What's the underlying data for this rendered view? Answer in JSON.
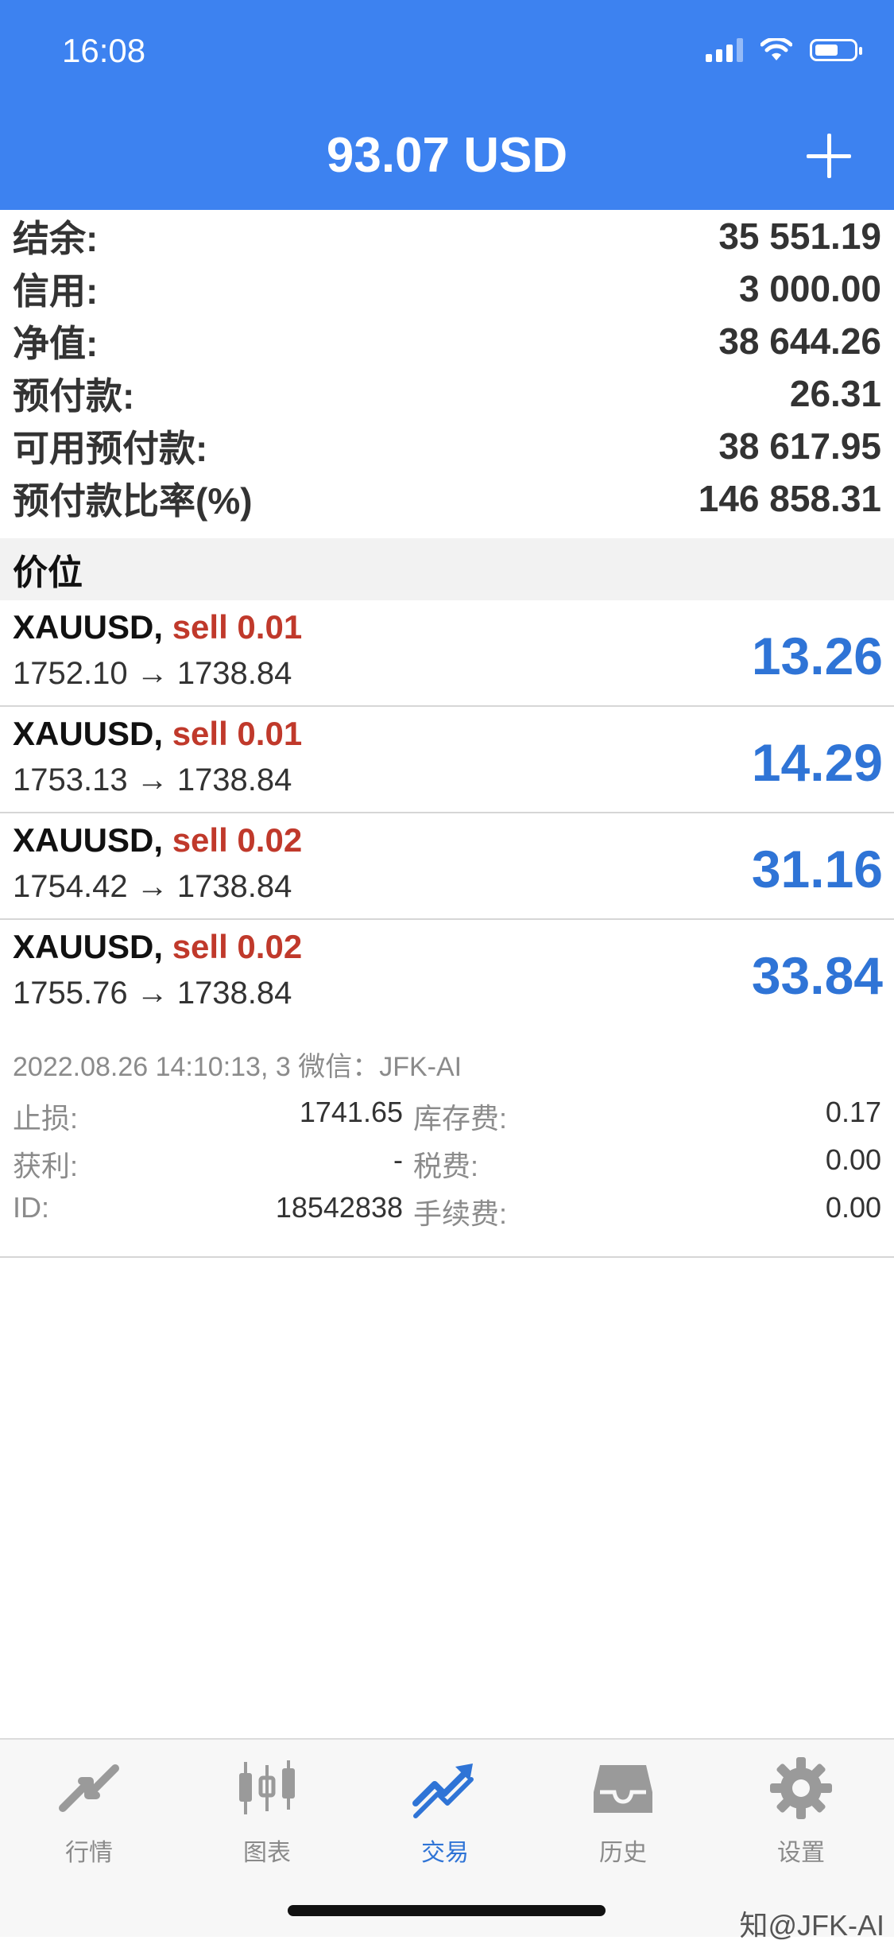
{
  "status": {
    "time": "16:08"
  },
  "header": {
    "balance": "93.07 USD"
  },
  "summary": [
    {
      "label": "结余:",
      "value": "35 551.19"
    },
    {
      "label": "信用:",
      "value": "3 000.00"
    },
    {
      "label": "净值:",
      "value": "38 644.26"
    },
    {
      "label": "预付款:",
      "value": "26.31"
    },
    {
      "label": "可用预付款:",
      "value": "38 617.95"
    },
    {
      "label": "预付款比率(%)",
      "value": "146 858.31"
    }
  ],
  "section": {
    "title": "价位"
  },
  "positions": [
    {
      "symbol": "XAUUSD,",
      "side": "sell 0.01",
      "prices": "1752.10 → 1738.84",
      "profit": "13.26"
    },
    {
      "symbol": "XAUUSD,",
      "side": "sell 0.01",
      "prices": "1753.13 → 1738.84",
      "profit": "14.29"
    },
    {
      "symbol": "XAUUSD,",
      "side": "sell 0.02",
      "prices": "1754.42 → 1738.84",
      "profit": "31.16"
    },
    {
      "symbol": "XAUUSD,",
      "side": "sell 0.02",
      "prices": "1755.76 → 1738.84",
      "profit": "33.84"
    }
  ],
  "details": {
    "meta": "2022.08.26 14:10:13, 3 微信：JFK-AI",
    "rows": [
      {
        "l1": "止损:",
        "v1": "1741.65",
        "l2": "库存费:",
        "v2": "0.17"
      },
      {
        "l1": "获利:",
        "v1": "-",
        "l2": "税费:",
        "v2": "0.00"
      },
      {
        "l1": "ID:",
        "v1": "18542838",
        "l2": "手续费:",
        "v2": "0.00"
      }
    ]
  },
  "tabs": [
    {
      "label": "行情",
      "icon": "quotes-icon"
    },
    {
      "label": "图表",
      "icon": "chart-candles-icon"
    },
    {
      "label": "交易",
      "icon": "trade-icon"
    },
    {
      "label": "历史",
      "icon": "history-icon"
    },
    {
      "label": "设置",
      "icon": "settings-icon"
    }
  ],
  "watermark": "知@JFK-AI",
  "colors": {
    "header": "#3d82f0",
    "profit": "#2f74d6",
    "sell": "#c0392b",
    "tab_active": "#2f74d6"
  }
}
